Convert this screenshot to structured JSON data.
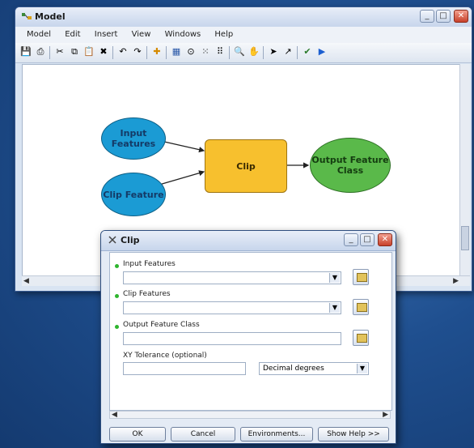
{
  "model_window": {
    "title": "Model",
    "menu": [
      "Model",
      "Edit",
      "Insert",
      "View",
      "Windows",
      "Help"
    ],
    "toolbar_icons": [
      "save-icon",
      "print-icon",
      "cut-icon",
      "copy-icon",
      "paste-icon",
      "delete-icon",
      "undo-icon",
      "redo-icon",
      "add-data-icon",
      "grid-layout-icon",
      "full-extent-icon",
      "select-all-icon",
      "auto-layout-icon",
      "zoom-in-icon",
      "pan-icon",
      "pointer-icon",
      "connect-icon",
      "validate-icon",
      "run-icon"
    ],
    "nodes": {
      "input_features": "Input Features",
      "clip_feature": "Clip Feature",
      "clip_tool": "Clip",
      "output": "Output Feature Class"
    },
    "colors": {
      "input": "#1b9bd4",
      "tool": "#f7c02e",
      "output": "#5ab94a"
    }
  },
  "clip_dialog": {
    "title": "Clip",
    "fields": {
      "input_features_label": "Input Features",
      "clip_features_label": "Clip Features",
      "output_feature_class_label": "Output Feature Class",
      "xy_tolerance_label": "XY Tolerance (optional)",
      "units_value": "Decimal degrees"
    },
    "buttons": {
      "ok": "OK",
      "cancel": "Cancel",
      "environments": "Environments...",
      "show_help": "Show Help >>"
    }
  }
}
